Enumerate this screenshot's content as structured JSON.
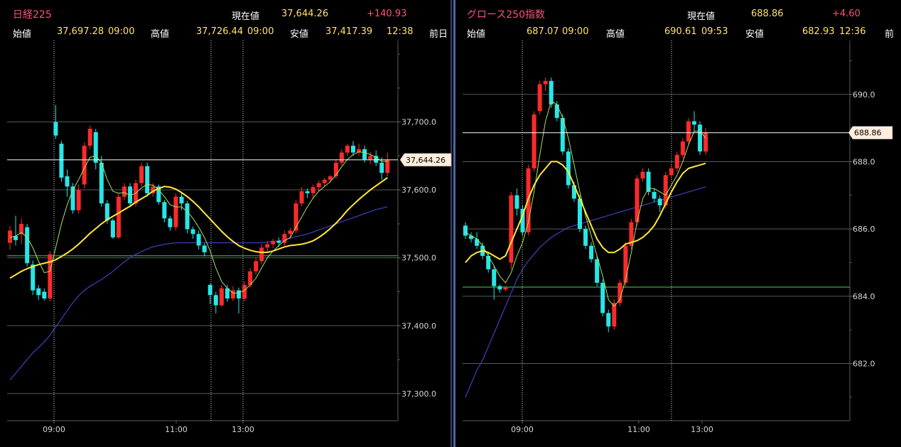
{
  "colors": {
    "up": "#ff2a2a",
    "down": "#29e6e6",
    "ma_short": "#a6e060",
    "ma_mid": "#ffe83a",
    "ma_long": "#4040c0",
    "grid": "#5a5a5a",
    "open_line": "#4cd24c",
    "price_line": "#ffffff",
    "tag_bg": "#ffeedd"
  },
  "panels": [
    {
      "title": "日経225",
      "current_label": "現在値",
      "current": "37,644.26",
      "change": "+140.93",
      "open_label": "始値",
      "open": "37,697.28",
      "open_time": "09:00",
      "high_label": "高値",
      "high": "37,726.44",
      "high_time": "09:00",
      "low_label": "安値",
      "low": "37,417.39",
      "low_time": "12:38",
      "prev_label": "前日",
      "price_tag": "37,644.26",
      "chart_data": {
        "type": "candlestick",
        "x_ticks": [
          "09:00",
          "11:00",
          "13:00"
        ],
        "y_ticks": [
          "37,700.0",
          "37,600.0",
          "37,500.0",
          "37,400.0",
          "37,300.0"
        ],
        "ylim": [
          37260,
          37820
        ],
        "open_line": 37503,
        "last_price": 37644.26,
        "candles": [
          [
            37522,
            37540,
            37512,
            37547
          ],
          [
            37532,
            37526,
            37518,
            37562
          ],
          [
            37535,
            37550,
            37520,
            37558
          ],
          [
            37545,
            37492,
            37487,
            37550
          ],
          [
            37490,
            37452,
            37445,
            37496
          ],
          [
            37455,
            37445,
            37438,
            37460
          ],
          [
            37450,
            37440,
            37437,
            37455
          ],
          [
            37440,
            37505,
            37436,
            37510
          ],
          [
            37700,
            37680,
            37675,
            37725
          ],
          [
            37668,
            37618,
            37612,
            37672
          ],
          [
            37620,
            37605,
            37590,
            37630
          ],
          [
            37605,
            37570,
            37565,
            37610
          ],
          [
            37570,
            37600,
            37565,
            37608
          ],
          [
            37608,
            37665,
            37602,
            37670
          ],
          [
            37665,
            37690,
            37660,
            37695
          ],
          [
            37685,
            37640,
            37630,
            37690
          ],
          [
            37640,
            37580,
            37575,
            37650
          ],
          [
            37580,
            37555,
            37550,
            37585
          ],
          [
            37555,
            37530,
            37528,
            37558
          ],
          [
            37530,
            37590,
            37528,
            37596
          ],
          [
            37590,
            37605,
            37585,
            37610
          ],
          [
            37605,
            37580,
            37575,
            37610
          ],
          [
            37580,
            37610,
            37575,
            37615
          ],
          [
            37610,
            37635,
            37605,
            37640
          ],
          [
            37635,
            37595,
            37590,
            37640
          ],
          [
            37595,
            37605,
            37590,
            37610
          ],
          [
            37605,
            37582,
            37578,
            37608
          ],
          [
            37582,
            37558,
            37552,
            37585
          ],
          [
            37558,
            37545,
            37540,
            37562
          ],
          [
            37545,
            37590,
            37540,
            37595
          ],
          [
            37590,
            37580,
            37570,
            37595
          ],
          [
            37580,
            37542,
            37536,
            37584
          ],
          [
            37542,
            37535,
            37528,
            37546
          ],
          [
            37535,
            37518,
            37512,
            37540
          ],
          [
            37518,
            37508,
            37502,
            37521
          ],
          [
            37460,
            37445,
            37432,
            37462
          ],
          [
            37445,
            37430,
            37418,
            37450
          ],
          [
            37430,
            37455,
            37428,
            37460
          ],
          [
            37455,
            37440,
            37435,
            37460
          ],
          [
            37440,
            37452,
            37436,
            37458
          ],
          [
            37452,
            37440,
            37418,
            37456
          ],
          [
            37440,
            37460,
            37436,
            37465
          ],
          [
            37460,
            37480,
            37456,
            37485
          ],
          [
            37480,
            37495,
            37475,
            37500
          ],
          [
            37495,
            37515,
            37490,
            37520
          ],
          [
            37515,
            37520,
            37508,
            37525
          ],
          [
            37520,
            37525,
            37514,
            37528
          ],
          [
            37525,
            37522,
            37516,
            37530
          ],
          [
            37522,
            37535,
            37518,
            37540
          ],
          [
            37535,
            37540,
            37528,
            37544
          ],
          [
            37540,
            37580,
            37536,
            37585
          ],
          [
            37580,
            37598,
            37576,
            37604
          ],
          [
            37598,
            37595,
            37588,
            37602
          ],
          [
            37595,
            37604,
            37588,
            37608
          ],
          [
            37604,
            37610,
            37598,
            37614
          ],
          [
            37610,
            37615,
            37604,
            37618
          ],
          [
            37615,
            37620,
            37610,
            37622
          ],
          [
            37620,
            37640,
            37616,
            37645
          ],
          [
            37640,
            37655,
            37636,
            37660
          ],
          [
            37655,
            37665,
            37650,
            37668
          ],
          [
            37665,
            37655,
            37650,
            37672
          ],
          [
            37655,
            37660,
            37650,
            37668
          ],
          [
            37660,
            37645,
            37640,
            37665
          ],
          [
            37645,
            37650,
            37638,
            37656
          ],
          [
            37650,
            37640,
            37635,
            37658
          ],
          [
            37640,
            37625,
            37615,
            37648
          ],
          [
            37625,
            37644,
            37620,
            37655
          ]
        ],
        "ma_short": [
          37530,
          37532,
          37537,
          37530,
          37515,
          37495,
          37478,
          37480,
          37515,
          37550,
          37578,
          37600,
          37615,
          37632,
          37648,
          37650,
          37640,
          37615,
          37598,
          37595,
          37596,
          37592,
          37595,
          37603,
          37608,
          37607,
          37600,
          37590,
          37578,
          37575,
          37575,
          37568,
          37558,
          37545,
          37530,
          37510,
          37485,
          37465,
          37455,
          37448,
          37448,
          37452,
          37460,
          37470,
          37485,
          37500,
          37510,
          37518,
          37525,
          37530,
          37545,
          37560,
          37575,
          37588,
          37598,
          37605,
          37612,
          37622,
          37634,
          37645,
          37652,
          37656,
          37655,
          37652,
          37648,
          37642,
          37642
        ],
        "ma_mid": [
          37470,
          37475,
          37480,
          37484,
          37487,
          37490,
          37492,
          37494,
          37497,
          37502,
          37507,
          37513,
          37520,
          37528,
          37536,
          37543,
          37550,
          37556,
          37561,
          37566,
          37571,
          37576,
          37582,
          37587,
          37592,
          37598,
          37602,
          37605,
          37604,
          37601,
          37596,
          37590,
          37583,
          37575,
          37566,
          37557,
          37548,
          37539,
          37531,
          37524,
          37518,
          37514,
          37511,
          37509,
          37508,
          37508,
          37510,
          37513,
          37516,
          37518,
          37519,
          37520,
          37522,
          37525,
          37530,
          37536,
          37543,
          37551,
          37560,
          37570,
          37578,
          37586,
          37593,
          37600,
          37606,
          37612,
          37618
        ],
        "ma_long": [
          37320,
          37330,
          37340,
          37350,
          37360,
          37368,
          37376,
          37386,
          37398,
          37410,
          37422,
          37434,
          37444,
          37452,
          37458,
          37463,
          37468,
          37474,
          37480,
          37487,
          37494,
          37500,
          37505,
          37509,
          37513,
          37516,
          37518,
          37520,
          37521,
          37522,
          37522,
          37522,
          37522,
          37522,
          37522,
          37522,
          37522,
          37522,
          37522,
          37522,
          37522,
          37522,
          37522,
          37522,
          37522,
          37523,
          37524,
          37525,
          37527,
          37529,
          37531,
          37533,
          37535,
          37538,
          37541,
          37544,
          37547,
          37550,
          37553,
          37556,
          37559,
          37562,
          37565,
          37568,
          37571,
          37573,
          37575
        ]
      }
    },
    {
      "title": "グロース250指数",
      "current_label": "現在値",
      "current": "688.86",
      "change": "+4.60",
      "open_label": "始値",
      "open": "687.07",
      "open_time": "09:00",
      "high_label": "高値",
      "high": "690.61",
      "high_time": "09:53",
      "low_label": "安値",
      "low": "682.93",
      "low_time": "12:36",
      "prev_label": "前",
      "price_tag": "688.86",
      "chart_data": {
        "type": "candlestick",
        "x_ticks": [
          "09:00",
          "11:00",
          "13:00"
        ],
        "y_ticks": [
          "690.0",
          "688.0",
          "686.0",
          "684.0",
          "682.0"
        ],
        "ylim": [
          680.3,
          691.6
        ],
        "open_line": 684.27,
        "last_price": 688.86,
        "candles": [
          [
            686.1,
            685.8,
            685.7,
            686.2
          ],
          [
            685.8,
            685.7,
            685.6,
            685.9
          ],
          [
            685.7,
            685.5,
            685.4,
            685.9
          ],
          [
            685.5,
            685.2,
            685.1,
            685.6
          ],
          [
            685.2,
            684.8,
            684.7,
            685.3
          ],
          [
            684.8,
            684.3,
            683.9,
            684.9
          ],
          [
            684.3,
            684.2,
            684.1,
            684.35
          ],
          [
            684.2,
            684.27,
            684.15,
            684.3
          ],
          [
            685.0,
            687.0,
            684.8,
            687.1
          ],
          [
            687.0,
            686.6,
            686.4,
            687.2
          ],
          [
            686.6,
            685.9,
            685.8,
            686.7
          ],
          [
            685.9,
            687.8,
            685.8,
            687.9
          ],
          [
            687.8,
            689.4,
            687.7,
            689.5
          ],
          [
            689.5,
            690.3,
            689.4,
            690.4
          ],
          [
            690.3,
            690.4,
            690.1,
            690.5
          ],
          [
            690.4,
            689.7,
            689.6,
            690.5
          ],
          [
            689.7,
            689.3,
            689.2,
            689.8
          ],
          [
            689.3,
            688.3,
            688.2,
            689.4
          ],
          [
            688.3,
            687.3,
            687.2,
            688.4
          ],
          [
            687.3,
            686.9,
            686.8,
            687.4
          ],
          [
            686.9,
            686.0,
            685.9,
            687.0
          ],
          [
            686.0,
            685.5,
            685.4,
            686.1
          ],
          [
            685.5,
            685.1,
            685.0,
            685.6
          ],
          [
            685.1,
            684.4,
            684.3,
            685.2
          ],
          [
            684.4,
            683.5,
            683.4,
            684.5
          ],
          [
            683.5,
            683.1,
            682.93,
            683.6
          ],
          [
            683.1,
            683.8,
            683.0,
            683.9
          ],
          [
            683.8,
            684.4,
            683.7,
            684.5
          ],
          [
            684.4,
            685.5,
            684.3,
            685.6
          ],
          [
            685.5,
            686.2,
            685.4,
            686.3
          ],
          [
            686.2,
            687.5,
            686.1,
            687.6
          ],
          [
            687.5,
            687.7,
            687.4,
            687.8
          ],
          [
            687.7,
            687.1,
            687.0,
            687.8
          ],
          [
            687.1,
            686.9,
            686.8,
            687.2
          ],
          [
            686.9,
            686.7,
            686.5,
            687.0
          ],
          [
            686.7,
            687.6,
            686.6,
            687.7
          ],
          [
            687.6,
            687.8,
            687.5,
            687.9
          ],
          [
            687.8,
            688.2,
            687.7,
            688.3
          ],
          [
            688.2,
            688.6,
            688.1,
            688.7
          ],
          [
            688.6,
            689.2,
            688.5,
            689.3
          ],
          [
            689.2,
            689.1,
            688.9,
            689.5
          ],
          [
            689.1,
            688.3,
            688.2,
            689.2
          ],
          [
            688.3,
            688.86,
            688.2,
            689.0
          ]
        ],
        "ma_short": [
          685.9,
          685.8,
          685.7,
          685.5,
          685.2,
          684.9,
          684.6,
          684.4,
          684.7,
          685.2,
          685.6,
          686.2,
          687.1,
          688.2,
          689.2,
          689.8,
          689.7,
          689.3,
          688.7,
          687.9,
          687.1,
          686.4,
          685.8,
          685.2,
          684.6,
          683.9,
          683.7,
          683.9,
          684.5,
          685.3,
          686.2,
          686.9,
          687.2,
          687.2,
          687.1,
          687.0,
          687.3,
          687.6,
          688.0,
          688.5,
          688.9,
          688.9,
          688.7
        ],
        "ma_mid": [
          685.0,
          685.2,
          685.3,
          685.35,
          685.3,
          685.2,
          685.1,
          685.2,
          685.6,
          686.0,
          686.4,
          686.9,
          687.3,
          687.6,
          687.8,
          688.0,
          688.0,
          687.9,
          687.7,
          687.3,
          686.9,
          686.5,
          686.1,
          685.7,
          685.45,
          685.3,
          685.3,
          685.4,
          685.55,
          685.6,
          685.65,
          685.75,
          685.9,
          686.1,
          686.4,
          686.75,
          687.1,
          687.4,
          687.65,
          687.8,
          687.85,
          687.9,
          687.95
        ],
        "ma_long": [
          681.0,
          681.4,
          681.8,
          682.1,
          682.5,
          682.9,
          683.3,
          683.7,
          684.1,
          684.5,
          684.8,
          685.05,
          685.25,
          685.45,
          685.6,
          685.75,
          685.85,
          685.95,
          686.05,
          686.1,
          686.15,
          686.2,
          686.25,
          686.3,
          686.35,
          686.4,
          686.45,
          686.5,
          686.55,
          686.6,
          686.65,
          686.7,
          686.75,
          686.8,
          686.85,
          686.9,
          686.95,
          687.0,
          687.05,
          687.1,
          687.15,
          687.2,
          687.25
        ]
      }
    }
  ]
}
